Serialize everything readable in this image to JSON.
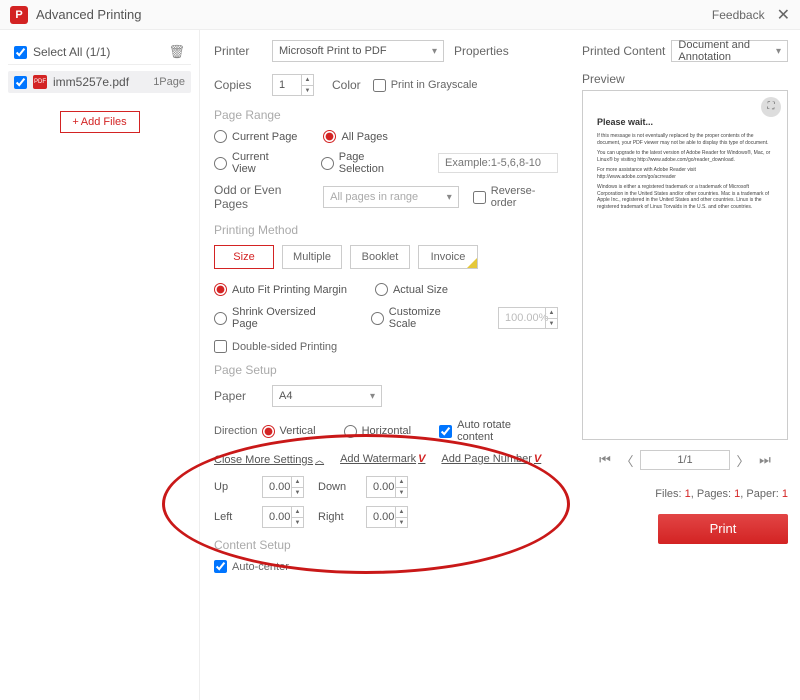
{
  "titlebar": {
    "title": "Advanced Printing",
    "feedback": "Feedback"
  },
  "sidebar": {
    "select_all": "Select All (1/1)",
    "file_name": "imm5257e.pdf",
    "file_pages": "1Page",
    "add_files": "Add Files"
  },
  "printer": {
    "label": "Printer",
    "value": "Microsoft Print to PDF",
    "properties": "Properties",
    "copies_label": "Copies",
    "copies_value": "1",
    "color_label": "Color",
    "grayscale": "Print in Grayscale"
  },
  "page_range": {
    "title": "Page Range",
    "current_page": "Current Page",
    "all_pages": "All Pages",
    "current_view": "Current View",
    "page_selection": "Page Selection",
    "selection_placeholder": "Example:1-5,6,8-10",
    "odd_even_label": "Odd or Even Pages",
    "odd_even_value": "All pages in range",
    "reverse": "Reverse-order"
  },
  "method": {
    "title": "Printing Method",
    "size": "Size",
    "multiple": "Multiple",
    "booklet": "Booklet",
    "invoice": "Invoice",
    "auto_fit": "Auto Fit Printing Margin",
    "actual": "Actual Size",
    "shrink": "Shrink Oversized Page",
    "custom": "Customize Scale",
    "custom_value": "100.00%",
    "double_sided": "Double-sided Printing"
  },
  "setup": {
    "title": "Page Setup",
    "paper_label": "Paper",
    "paper_value": "A4",
    "direction_label": "Direction",
    "vertical": "Vertical",
    "horizontal": "Horizontal",
    "auto_rotate": "Auto rotate content",
    "close_more": "Close More Settings",
    "add_watermark": "Add Watermark",
    "add_page_no": "Add Page Number",
    "up": "Up",
    "down": "Down",
    "left": "Left",
    "right": "Right",
    "mval": "0.00"
  },
  "content": {
    "title": "Content Setup",
    "auto_center": "Auto-center"
  },
  "right": {
    "printed_content_label": "Printed Content",
    "printed_content_value": "Document and Annotation",
    "preview_label": "Preview",
    "wait_title": "Please wait...",
    "wait_l1": "If this message is not eventually replaced by the proper contents of the document, your PDF viewer may not be able to display this type of document.",
    "wait_l2": "You can upgrade to the latest version of Adobe Reader for Windows®, Mac, or Linux® by visiting http://www.adobe.com/go/reader_download.",
    "wait_l3": "For more assistance with Adobe Reader visit http://www.adobe.com/go/acrreader",
    "wait_l4": "Windows is either a registered trademark or a trademark of Microsoft Corporation in the United States and/or other countries. Mac is a trademark of Apple Inc., registered in the United States and other countries. Linux is the registered trademark of Linus Torvalds in the U.S. and other countries.",
    "page_indicator": "1/1",
    "files_label": "Files: ",
    "pages_label": ", Pages: ",
    "paper_label": ", Paper: ",
    "files": "1",
    "pages": "1",
    "paper": "1",
    "print": "Print"
  }
}
